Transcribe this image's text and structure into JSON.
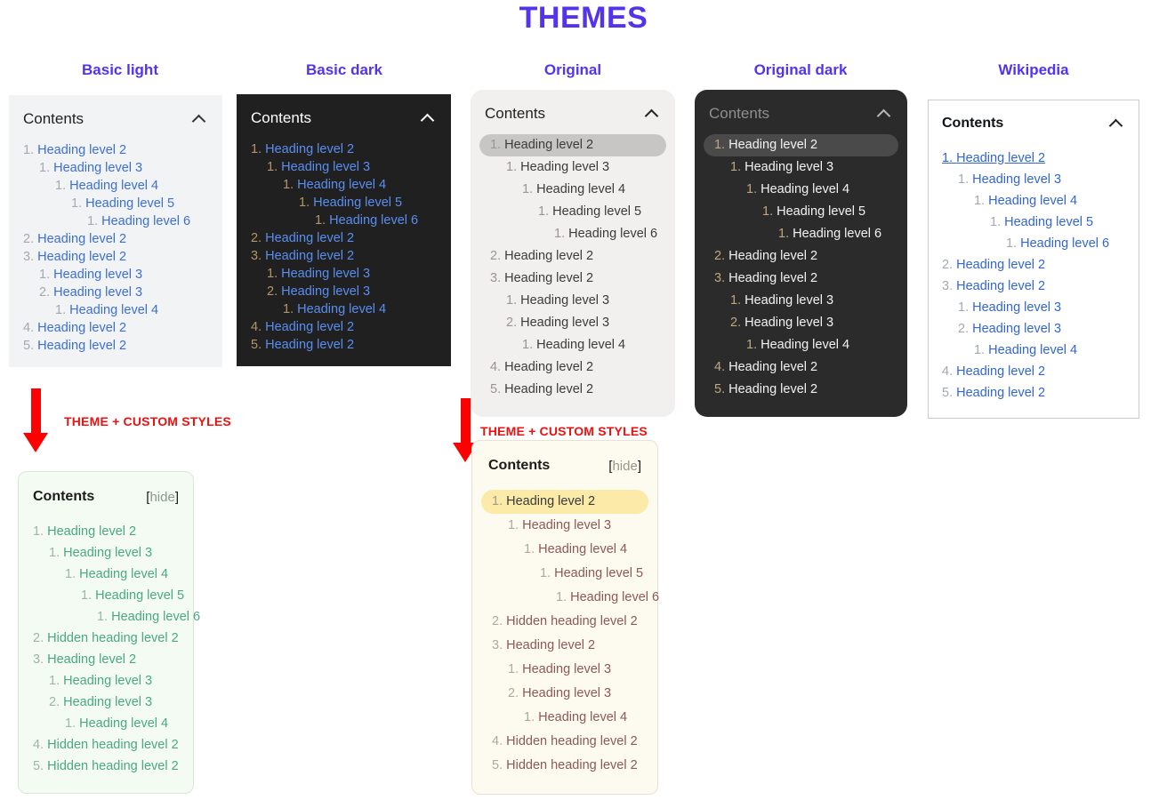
{
  "page": {
    "title": "THEMES",
    "title_color": "#5433ee"
  },
  "columns": [
    {
      "id": "basic-light",
      "label": "Basic light"
    },
    {
      "id": "basic-dark",
      "label": "Basic dark"
    },
    {
      "id": "original",
      "label": "Original"
    },
    {
      "id": "original-dark",
      "label": "Original dark"
    },
    {
      "id": "wikipedia",
      "label": "Wikipedia"
    }
  ],
  "annotations": [
    {
      "id": "anno-left",
      "label": "THEME + CUSTOM STYLES",
      "color": "#f01010",
      "icon": "down-arrow-icon"
    },
    {
      "id": "anno-middle",
      "label": "THEME + CUSTOM STYLES",
      "color": "#f01010",
      "icon": "down-arrow-icon"
    }
  ],
  "panels": {
    "basic_light": {
      "heading": "Contents",
      "toggle_icon": "chevron-up-icon",
      "items": [
        {
          "num": "1.",
          "text": "Heading level 2",
          "level": 2,
          "active": false
        },
        {
          "num": "1.",
          "text": "Heading level 3",
          "level": 3,
          "active": false
        },
        {
          "num": "1.",
          "text": "Heading level 4",
          "level": 4,
          "active": false
        },
        {
          "num": "1.",
          "text": "Heading level 5",
          "level": 5,
          "active": false
        },
        {
          "num": "1.",
          "text": "Heading level 6",
          "level": 6,
          "active": false
        },
        {
          "num": "2.",
          "text": "Heading level 2",
          "level": 2,
          "active": false
        },
        {
          "num": "3.",
          "text": "Heading level 2",
          "level": 2,
          "active": false
        },
        {
          "num": "1.",
          "text": "Heading level 3",
          "level": 3,
          "active": false
        },
        {
          "num": "2.",
          "text": "Heading level 3",
          "level": 3,
          "active": false
        },
        {
          "num": "1.",
          "text": "Heading level 4",
          "level": 4,
          "active": false
        },
        {
          "num": "4.",
          "text": "Heading level 2",
          "level": 2,
          "active": false
        },
        {
          "num": "5.",
          "text": "Heading level 2",
          "level": 2,
          "active": false
        }
      ]
    },
    "basic_dark": {
      "heading": "Contents",
      "toggle_icon": "chevron-up-icon",
      "items": [
        {
          "num": "1.",
          "text": "Heading level 2",
          "level": 2,
          "active": false
        },
        {
          "num": "1.",
          "text": "Heading level 3",
          "level": 3,
          "active": false
        },
        {
          "num": "1.",
          "text": "Heading level 4",
          "level": 4,
          "active": false
        },
        {
          "num": "1.",
          "text": "Heading level 5",
          "level": 5,
          "active": false
        },
        {
          "num": "1.",
          "text": "Heading level 6",
          "level": 6,
          "active": false
        },
        {
          "num": "2.",
          "text": "Heading level 2",
          "level": 2,
          "active": false
        },
        {
          "num": "3.",
          "text": "Heading level 2",
          "level": 2,
          "active": false
        },
        {
          "num": "1.",
          "text": "Heading level 3",
          "level": 3,
          "active": false
        },
        {
          "num": "2.",
          "text": "Heading level 3",
          "level": 3,
          "active": false
        },
        {
          "num": "1.",
          "text": "Heading level 4",
          "level": 4,
          "active": false
        },
        {
          "num": "4.",
          "text": "Heading level 2",
          "level": 2,
          "active": false
        },
        {
          "num": "5.",
          "text": "Heading level 2",
          "level": 2,
          "active": false
        }
      ]
    },
    "original": {
      "heading": "Contents",
      "toggle_icon": "chevron-up-icon",
      "items": [
        {
          "num": "1.",
          "text": "Heading level 2",
          "level": 2,
          "active": true
        },
        {
          "num": "1.",
          "text": "Heading level 3",
          "level": 3,
          "active": false
        },
        {
          "num": "1.",
          "text": "Heading level 4",
          "level": 4,
          "active": false
        },
        {
          "num": "1.",
          "text": "Heading level 5",
          "level": 5,
          "active": false
        },
        {
          "num": "1.",
          "text": "Heading level 6",
          "level": 6,
          "active": false
        },
        {
          "num": "2.",
          "text": "Heading level 2",
          "level": 2,
          "active": false
        },
        {
          "num": "3.",
          "text": "Heading level 2",
          "level": 2,
          "active": false
        },
        {
          "num": "1.",
          "text": "Heading level 3",
          "level": 3,
          "active": false
        },
        {
          "num": "2.",
          "text": "Heading level 3",
          "level": 3,
          "active": false
        },
        {
          "num": "1.",
          "text": "Heading level 4",
          "level": 4,
          "active": false
        },
        {
          "num": "4.",
          "text": "Heading level 2",
          "level": 2,
          "active": false
        },
        {
          "num": "5.",
          "text": "Heading level 2",
          "level": 2,
          "active": false
        }
      ]
    },
    "original_dark": {
      "heading": "Contents",
      "toggle_icon": "chevron-up-icon",
      "items": [
        {
          "num": "1.",
          "text": "Heading level 2",
          "level": 2,
          "active": true
        },
        {
          "num": "1.",
          "text": "Heading level 3",
          "level": 3,
          "active": false
        },
        {
          "num": "1.",
          "text": "Heading level 4",
          "level": 4,
          "active": false
        },
        {
          "num": "1.",
          "text": "Heading level 5",
          "level": 5,
          "active": false
        },
        {
          "num": "1.",
          "text": "Heading level 6",
          "level": 6,
          "active": false
        },
        {
          "num": "2.",
          "text": "Heading level 2",
          "level": 2,
          "active": false
        },
        {
          "num": "3.",
          "text": "Heading level 2",
          "level": 2,
          "active": false
        },
        {
          "num": "1.",
          "text": "Heading level 3",
          "level": 3,
          "active": false
        },
        {
          "num": "2.",
          "text": "Heading level 3",
          "level": 3,
          "active": false
        },
        {
          "num": "1.",
          "text": "Heading level 4",
          "level": 4,
          "active": false
        },
        {
          "num": "4.",
          "text": "Heading level 2",
          "level": 2,
          "active": false
        },
        {
          "num": "5.",
          "text": "Heading level 2",
          "level": 2,
          "active": false
        }
      ]
    },
    "wikipedia": {
      "heading": "Contents",
      "toggle_icon": "chevron-up-icon",
      "items": [
        {
          "num": "1.",
          "text": "Heading level 2",
          "level": 2,
          "active": true
        },
        {
          "num": "1.",
          "text": "Heading level 3",
          "level": 3,
          "active": false
        },
        {
          "num": "1.",
          "text": "Heading level 4",
          "level": 4,
          "active": false
        },
        {
          "num": "1.",
          "text": "Heading level 5",
          "level": 5,
          "active": false
        },
        {
          "num": "1.",
          "text": "Heading level 6",
          "level": 6,
          "active": false
        },
        {
          "num": "2.",
          "text": "Heading level 2",
          "level": 2,
          "active": false
        },
        {
          "num": "3.",
          "text": "Heading level 2",
          "level": 2,
          "active": false
        },
        {
          "num": "1.",
          "text": "Heading level 3",
          "level": 3,
          "active": false
        },
        {
          "num": "2.",
          "text": "Heading level 3",
          "level": 3,
          "active": false
        },
        {
          "num": "1.",
          "text": "Heading level 4",
          "level": 4,
          "active": false
        },
        {
          "num": "4.",
          "text": "Heading level 2",
          "level": 2,
          "active": false
        },
        {
          "num": "5.",
          "text": "Heading level 2",
          "level": 2,
          "active": false
        }
      ]
    },
    "custom_green": {
      "heading": "Contents",
      "hide_open": "[",
      "hide_label": "hide",
      "hide_close": "]",
      "items": [
        {
          "num": "1.",
          "text": "Heading level 2",
          "level": 2,
          "active": false
        },
        {
          "num": "1.",
          "text": "Heading level 3",
          "level": 3,
          "active": false
        },
        {
          "num": "1.",
          "text": "Heading level 4",
          "level": 4,
          "active": false
        },
        {
          "num": "1.",
          "text": "Heading level 5",
          "level": 5,
          "active": false
        },
        {
          "num": "1.",
          "text": "Heading level 6",
          "level": 6,
          "active": false
        },
        {
          "num": "2.",
          "text": "Hidden heading level 2",
          "level": 2,
          "active": false
        },
        {
          "num": "3.",
          "text": "Heading level 2",
          "level": 2,
          "active": false
        },
        {
          "num": "1.",
          "text": "Heading level 3",
          "level": 3,
          "active": false
        },
        {
          "num": "2.",
          "text": "Heading level 3",
          "level": 3,
          "active": false
        },
        {
          "num": "1.",
          "text": "Heading level 4",
          "level": 4,
          "active": false
        },
        {
          "num": "4.",
          "text": "Hidden heading level 2",
          "level": 2,
          "active": false
        },
        {
          "num": "5.",
          "text": "Hidden heading level 2",
          "level": 2,
          "active": false
        }
      ]
    },
    "custom_cream": {
      "heading": "Contents",
      "hide_open": "[",
      "hide_label": "hide",
      "hide_close": "]",
      "items": [
        {
          "num": "1.",
          "text": "Heading level 2",
          "level": 2,
          "active": true
        },
        {
          "num": "1.",
          "text": "Heading level 3",
          "level": 3,
          "active": false
        },
        {
          "num": "1.",
          "text": "Heading level 4",
          "level": 4,
          "active": false
        },
        {
          "num": "1.",
          "text": "Heading level 5",
          "level": 5,
          "active": false
        },
        {
          "num": "1.",
          "text": "Heading level 6",
          "level": 6,
          "active": false
        },
        {
          "num": "2.",
          "text": "Hidden heading level 2",
          "level": 2,
          "active": false
        },
        {
          "num": "3.",
          "text": "Heading level 2",
          "level": 2,
          "active": false
        },
        {
          "num": "1.",
          "text": "Heading level 3",
          "level": 3,
          "active": false
        },
        {
          "num": "2.",
          "text": "Heading level 3",
          "level": 3,
          "active": false
        },
        {
          "num": "1.",
          "text": "Heading level 4",
          "level": 4,
          "active": false
        },
        {
          "num": "4.",
          "text": "Hidden heading level 2",
          "level": 2,
          "active": false
        },
        {
          "num": "5.",
          "text": "Hidden heading level 2",
          "level": 2,
          "active": false
        }
      ]
    }
  }
}
